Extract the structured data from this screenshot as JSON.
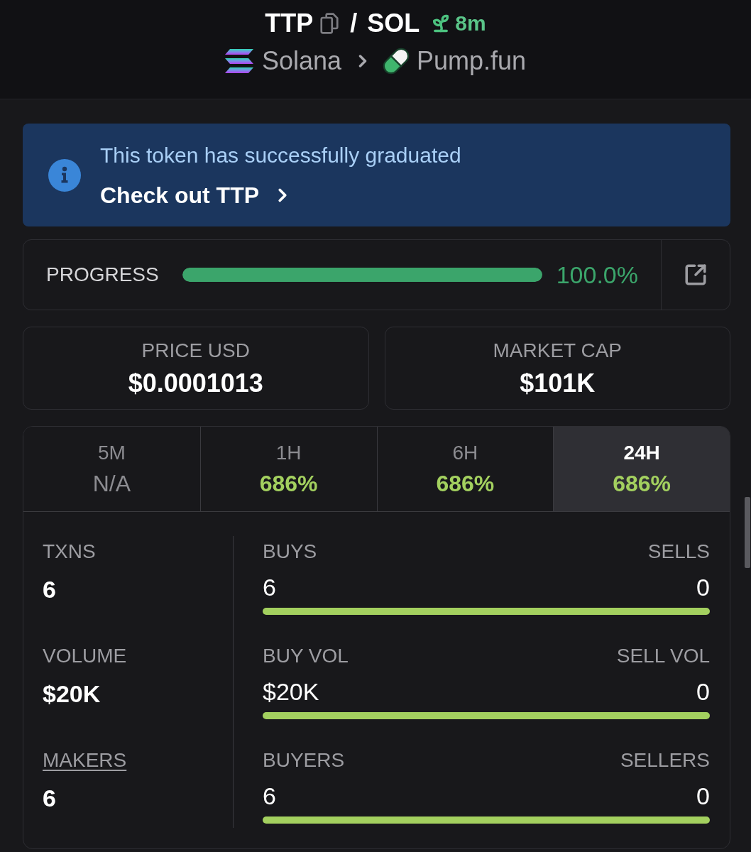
{
  "header": {
    "base_symbol": "TTP",
    "separator": "/",
    "quote_symbol": "SOL",
    "age": "8m",
    "chain": "Solana",
    "dex": "Pump.fun"
  },
  "banner": {
    "message": "This token has successfully graduated",
    "link": "Check out TTP"
  },
  "progress": {
    "label": "PROGRESS",
    "level": 1,
    "reading": "100.0%"
  },
  "price_cards": [
    {
      "label": "PRICE USD",
      "value": "$0.0001013"
    },
    {
      "label": "MARKET CAP",
      "value": "$101K"
    }
  ],
  "timeframes": [
    {
      "label": "5M",
      "change": "N/A",
      "kind": "none",
      "selected": false
    },
    {
      "label": "1H",
      "change": "686%",
      "kind": "up",
      "selected": false
    },
    {
      "label": "6H",
      "change": "686%",
      "kind": "up",
      "selected": false
    },
    {
      "label": "24H",
      "change": "686%",
      "kind": "up",
      "selected": true
    }
  ],
  "stats": [
    {
      "label": "TXNS",
      "value": "6",
      "underlined": false
    },
    {
      "label": "VOLUME",
      "value": "$20K",
      "underlined": false
    },
    {
      "label": "MAKERS",
      "value": "6",
      "underlined": true
    }
  ],
  "splits": [
    {
      "buy_label": "BUYS",
      "sell_label": "SELLS",
      "buy_value": "6",
      "sell_value": "0",
      "level": 1
    },
    {
      "buy_label": "BUY VOL",
      "sell_label": "SELL VOL",
      "buy_value": "$20K",
      "sell_value": "0",
      "level": 1
    },
    {
      "buy_label": "BUYERS",
      "sell_label": "SELLERS",
      "buy_value": "6",
      "sell_value": "0",
      "level": 1
    }
  ]
}
